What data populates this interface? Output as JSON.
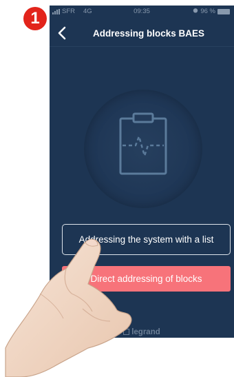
{
  "step_badge": "1",
  "status_bar": {
    "carrier": "SFR",
    "network": "4G",
    "time": "09:35",
    "battery": "96 %"
  },
  "header": {
    "title": "Addressing blocks BAES",
    "back_icon": "chevron-left-icon"
  },
  "hero": {
    "icon": "clipboard-pulse-icon"
  },
  "actions": {
    "list_button_label": "Addressing the system with a list",
    "direct_button_label": "Direct addressing of blocks"
  },
  "footer": {
    "brand": "legrand"
  },
  "colors": {
    "background": "#1d3553",
    "accent": "#f7737a",
    "badge": "#e2241b"
  }
}
